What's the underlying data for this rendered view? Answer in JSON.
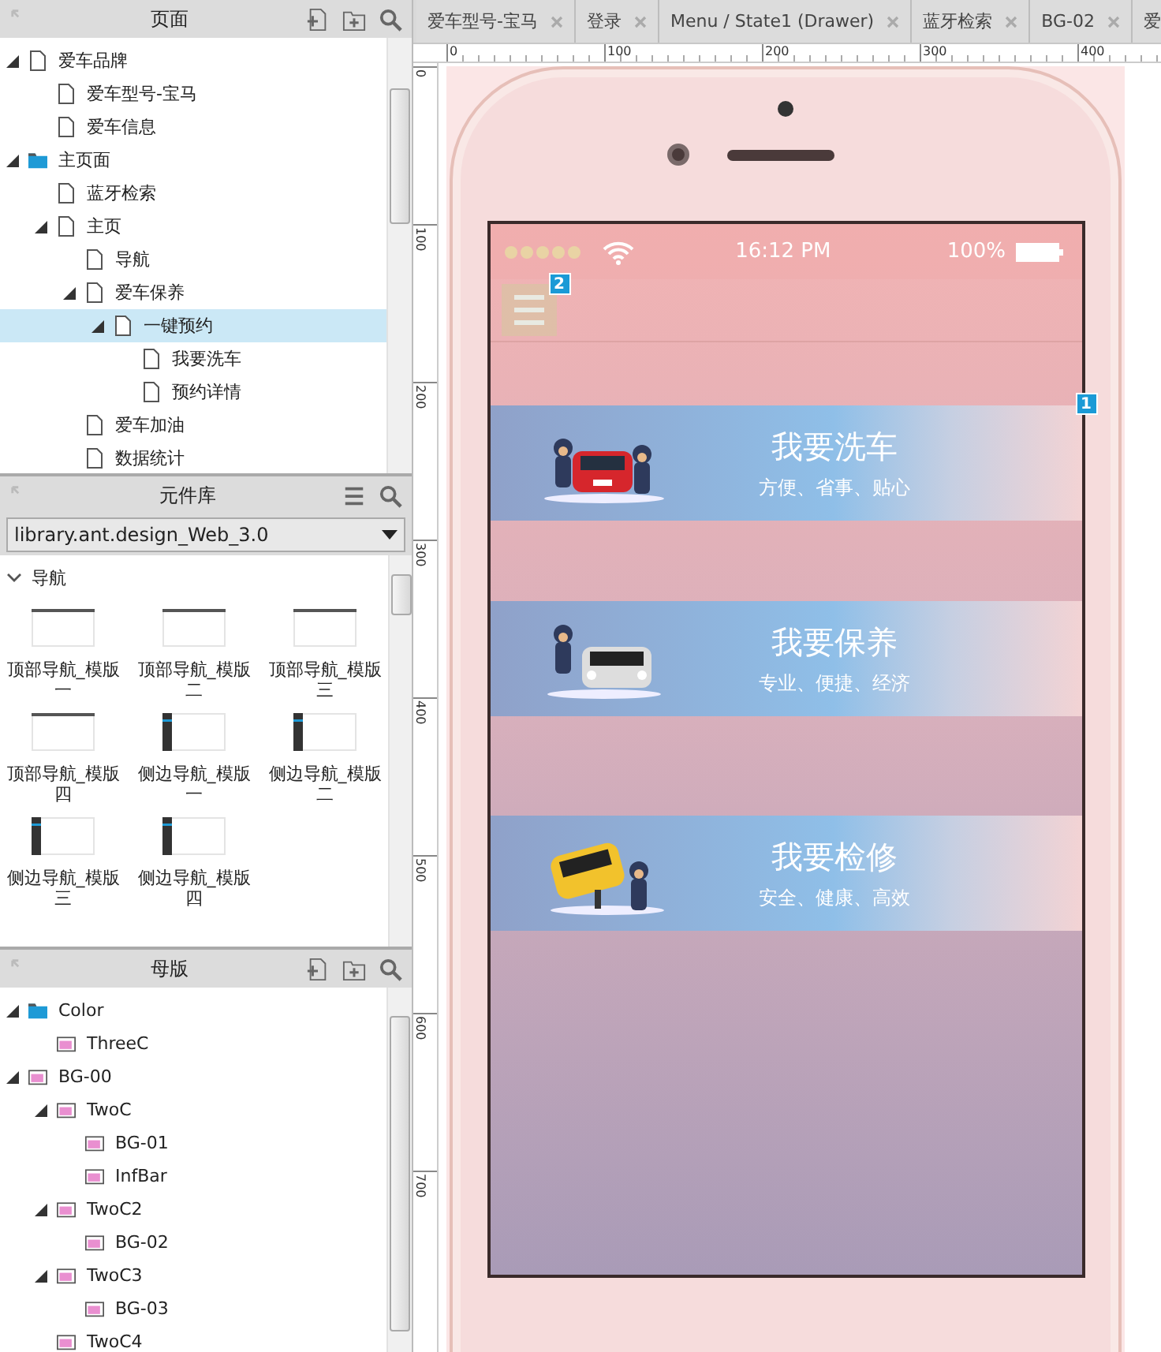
{
  "pages_panel": {
    "title": "页面",
    "items": [
      {
        "label": "爱车品牌",
        "kind": "page",
        "expanded": true,
        "selected": false,
        "children": [
          {
            "label": "爱车型号-宝马",
            "kind": "page",
            "selected": false
          },
          {
            "label": "爱车信息",
            "kind": "page",
            "selected": false
          }
        ]
      },
      {
        "label": "主页面",
        "kind": "folder",
        "expanded": true,
        "selected": false,
        "children": [
          {
            "label": "蓝牙检索",
            "kind": "page",
            "selected": false
          },
          {
            "label": "主页",
            "kind": "page",
            "expanded": true,
            "selected": false,
            "children": [
              {
                "label": "导航",
                "kind": "page",
                "selected": false
              },
              {
                "label": "爱车保养",
                "kind": "page",
                "expanded": true,
                "selected": false,
                "children": [
                  {
                    "label": "一键预约",
                    "kind": "page",
                    "expanded": true,
                    "selected": true,
                    "children": [
                      {
                        "label": "我要洗车",
                        "kind": "page",
                        "selected": false
                      },
                      {
                        "label": "预约详情",
                        "kind": "page",
                        "selected": false
                      }
                    ]
                  }
                ]
              },
              {
                "label": "爱车加油",
                "kind": "page",
                "selected": false
              },
              {
                "label": "数据统计",
                "kind": "page",
                "selected": false
              }
            ]
          }
        ]
      }
    ]
  },
  "library_panel": {
    "title": "元件库",
    "library": "library.ant.design_Web_3.0",
    "category": {
      "label": "导航",
      "expanded": true
    },
    "items": [
      {
        "label": "顶部导航_模版一",
        "kind": "top"
      },
      {
        "label": "顶部导航_模版二",
        "kind": "top"
      },
      {
        "label": "顶部导航_模版三",
        "kind": "top"
      },
      {
        "label": "顶部导航_模版四",
        "kind": "top"
      },
      {
        "label": "侧边导航_模版一",
        "kind": "side"
      },
      {
        "label": "侧边导航_模版二",
        "kind": "side"
      },
      {
        "label": "侧边导航_模版三",
        "kind": "side"
      },
      {
        "label": "侧边导航_模版四",
        "kind": "side"
      }
    ]
  },
  "masters_panel": {
    "title": "母版",
    "items": [
      {
        "label": "Color",
        "kind": "folder",
        "expanded": true,
        "selected": false,
        "children": [
          {
            "label": "ThreeC",
            "kind": "master",
            "selected": false
          }
        ]
      },
      {
        "label": "BG-00",
        "kind": "master",
        "expanded": true,
        "selected": false,
        "children": [
          {
            "label": "TwoC",
            "kind": "master",
            "expanded": true,
            "selected": false,
            "children": [
              {
                "label": "BG-01",
                "kind": "master",
                "selected": false
              },
              {
                "label": "InfBar",
                "kind": "master",
                "selected": false
              }
            ]
          },
          {
            "label": "TwoC2",
            "kind": "master",
            "expanded": true,
            "selected": false,
            "children": [
              {
                "label": "BG-02",
                "kind": "master",
                "selected": false
              }
            ]
          },
          {
            "label": "TwoC3",
            "kind": "master",
            "expanded": true,
            "selected": false,
            "children": [
              {
                "label": "BG-03",
                "kind": "master",
                "selected": false
              }
            ]
          },
          {
            "label": "TwoC4",
            "kind": "master",
            "selected": false
          }
        ]
      }
    ]
  },
  "tabs": [
    {
      "label": "爱车型号-宝马"
    },
    {
      "label": "登录"
    },
    {
      "label": "Menu / State1 (Drawer)"
    },
    {
      "label": "蓝牙检索"
    },
    {
      "label": "BG-02"
    },
    {
      "label": "爱"
    }
  ],
  "rulers": {
    "horizontal": [
      "0",
      "100",
      "200",
      "300",
      "400"
    ],
    "vertical": [
      "0",
      "100",
      "200",
      "300",
      "400",
      "500",
      "600",
      "700"
    ]
  },
  "phone": {
    "status_bar": {
      "time": "16:12 PM",
      "battery": "100%"
    },
    "menu_badge": "2",
    "side_badge": "1",
    "cards": [
      {
        "kind": "wash",
        "title": "我要洗车",
        "subtitle": "方便、省事、贴心"
      },
      {
        "kind": "maintain",
        "title": "我要保养",
        "subtitle": "专业、便捷、经济"
      },
      {
        "kind": "repair",
        "title": "我要检修",
        "subtitle": "安全、健康、高效"
      }
    ]
  }
}
